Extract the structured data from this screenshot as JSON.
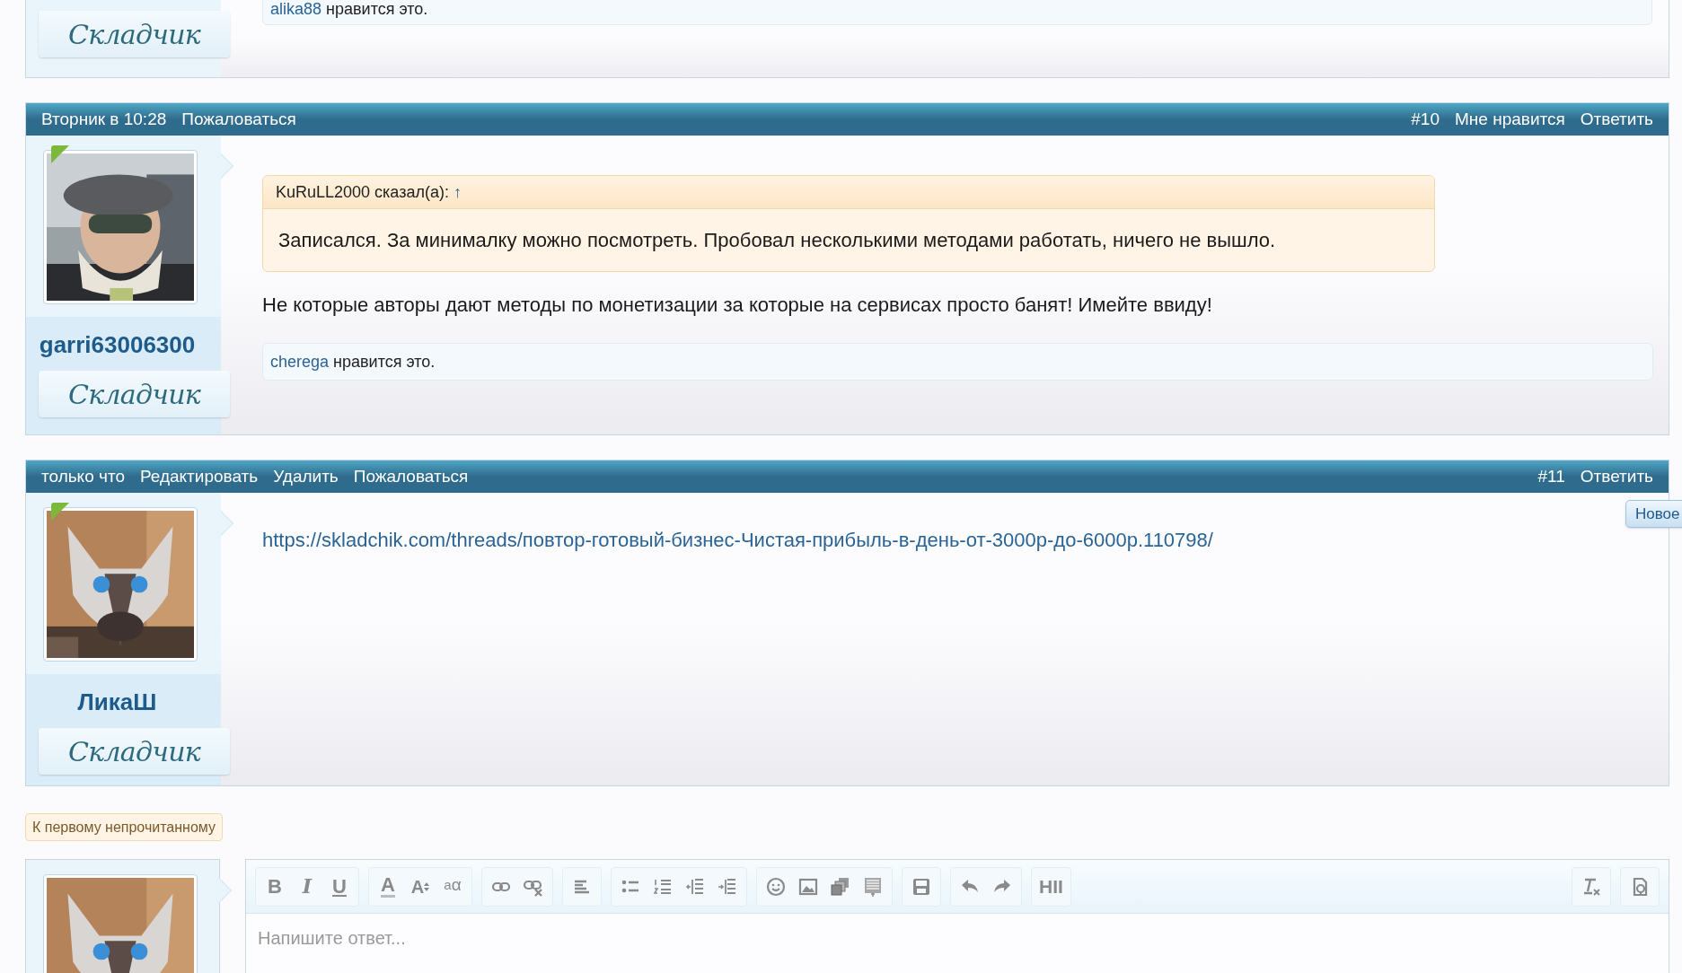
{
  "top_post": {
    "badge": "Складчик",
    "likes": {
      "user": "alika88",
      "text": "нравится это."
    }
  },
  "posts": [
    {
      "header_left": [
        "Вторник в 10:28",
        "Пожаловаться"
      ],
      "header_right": [
        "#10",
        "Мне нравится",
        "Ответить"
      ],
      "avatar": {
        "kind": "picture"
      },
      "online": true,
      "username": "garri63006300",
      "badge": "Складчик",
      "quote": {
        "author": "KuRuLL2000 сказал(а):",
        "arrow": "↑",
        "text": "Записался. За минималку можно посмотреть. Пробовал несколькими методами работать, ничего не вышло."
      },
      "body": "Не которые авторы дают методы по монетизации за которые на сервисах просто банят! Имейте ввиду!",
      "likes": {
        "user": "cherega",
        "text": "нравится это."
      }
    },
    {
      "header_left": [
        "только что",
        "Редактировать",
        "Удалить",
        "Пожаловаться"
      ],
      "header_right": [
        "#11",
        "Ответить"
      ],
      "avatar": {
        "kind": "picture"
      },
      "online": true,
      "username": "ЛикаШ",
      "badge": "Складчик",
      "link": "https://skladchik.com/threads/повтор-готовый-бизнес-Чистая-прибыль-в-день-от-3000р-до-6000р.110798/"
    }
  ],
  "new_button": "Новое",
  "unread_button": "К первому непрочитанному",
  "editor": {
    "toolbar_text": [
      "B",
      "I",
      "U",
      "A",
      "A",
      "a",
      "α",
      "HII"
    ],
    "placeholder": "Напишите ответ..."
  }
}
